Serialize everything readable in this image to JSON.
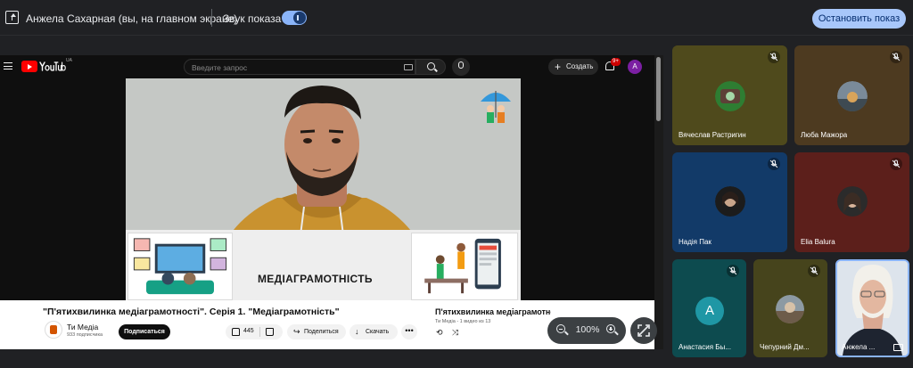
{
  "share_bar": {
    "presenter_label": "Анжела Сахарная (вы, на главном экране)",
    "sound_label": "Звук показа",
    "stop_label": "Остановить показ",
    "sound_enabled": true
  },
  "youtube": {
    "logo_text": "YouTube",
    "region": "UA",
    "search_placeholder": "Введите запрос",
    "create_label": "Создать",
    "notifications_badge": "9+",
    "avatar_letter": "A",
    "video": {
      "caption": "МЕДІАГРАМОТНІСТЬ",
      "title": "\"П'ятихвилинка медіаграмотності\". Серія 1. \"Медіаграмотність\""
    },
    "channel": {
      "name": "Ти Медіа",
      "subscribers": "933 подписчика",
      "subscribe_label": "Подписаться"
    },
    "actions": {
      "likes": "445",
      "share_label": "Поделиться",
      "download_label": "Скачать",
      "more_label": "•••"
    },
    "playlist": {
      "title": "П'ятихвилинка медіаграмотності",
      "meta": "Ти Медіа - 1 видео из 13"
    }
  },
  "zoom": {
    "level": "100%"
  },
  "participants": [
    {
      "name": "Вячеслав Растригин",
      "muted": true,
      "color": "#4f4a1c"
    },
    {
      "name": "Люба Мажора",
      "muted": true,
      "color": "#4d3a20"
    },
    {
      "name": "Надія Пак",
      "muted": true,
      "color": "#123a68"
    },
    {
      "name": "Elia Balura",
      "muted": true,
      "color": "#5c1f1b"
    },
    {
      "name": "Анастасия Бы...",
      "muted": true,
      "color": "#0d4b4f",
      "letter": "A"
    },
    {
      "name": "Чепурний Дм...",
      "muted": true,
      "color": "#46441c"
    },
    {
      "name": "Анжела ...",
      "muted": false,
      "color": "#dfe6ee"
    }
  ],
  "colors": {
    "accent": "#8ab4f8",
    "stop_button": "#a8c7fa",
    "yt_red": "#ff0000"
  }
}
